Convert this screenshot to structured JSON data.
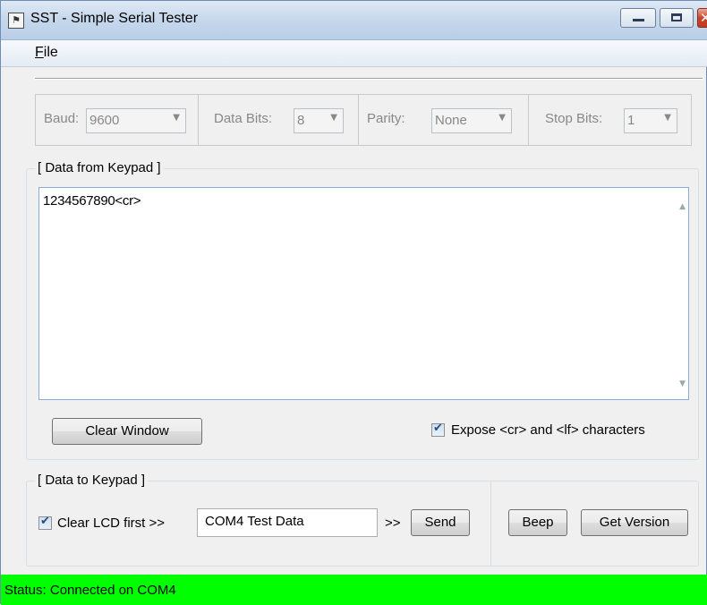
{
  "window": {
    "title": "SST - Simple Serial Tester"
  },
  "menu": {
    "file_prefix": "F",
    "file_rest": "ile"
  },
  "settings": {
    "baud": {
      "label": "Baud:",
      "value": "9600"
    },
    "data_bits": {
      "label": "Data Bits:",
      "value": "8"
    },
    "parity": {
      "label": "Parity:",
      "value": "None"
    },
    "stop_bits": {
      "label": "Stop Bits:",
      "value": "1"
    }
  },
  "data_from_keypad": {
    "title": "[ Data from Keypad ]",
    "content": "1234567890<cr>",
    "clear_button": "Clear Window",
    "expose_checkbox": {
      "checked": true,
      "label": "Expose <cr> and <lf> characters"
    }
  },
  "data_to_keypad": {
    "title": "[ Data to Keypad ]",
    "clear_lcd_checkbox": {
      "checked": true,
      "label": "Clear LCD first >>"
    },
    "input_value": "COM4 Test Data",
    "arrows": ">>",
    "send_button": "Send",
    "beep_button": "Beep",
    "get_version_button": "Get Version"
  },
  "status": {
    "text": "Status: Connected on COM4",
    "color": "#00ff00"
  }
}
